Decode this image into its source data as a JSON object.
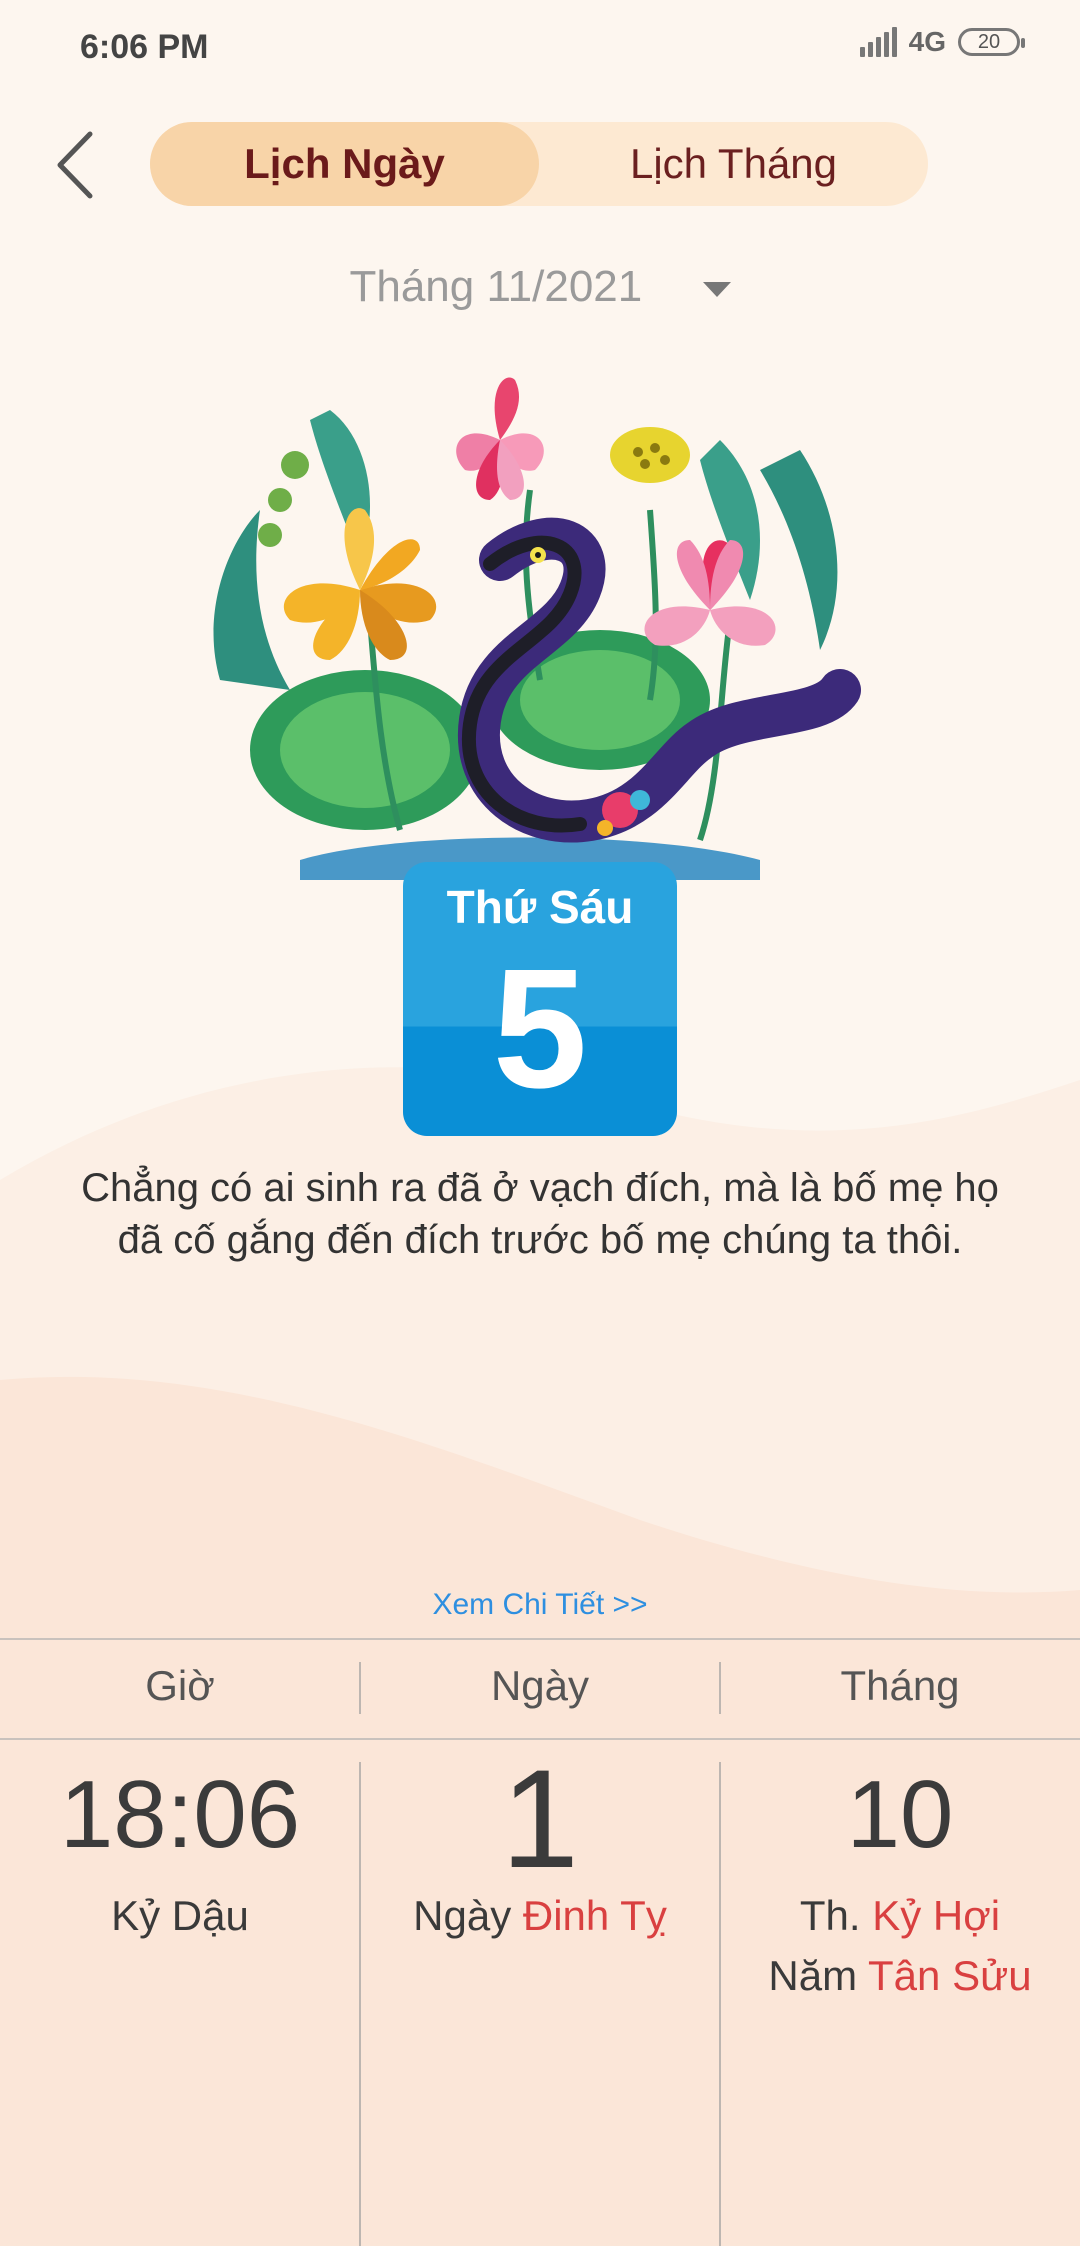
{
  "status_bar": {
    "time": "6:06 PM",
    "network": "4G",
    "battery": "20"
  },
  "tabs": [
    {
      "label": "Lịch Ngày",
      "active": true
    },
    {
      "label": "Lịch Tháng",
      "active": false
    }
  ],
  "month_selector": {
    "label": "Tháng 11/2021"
  },
  "day_card": {
    "weekday": "Thứ Sáu",
    "day": "5"
  },
  "quote": "Chẳng có ai sinh ra đã ở vạch đích, mà là bố mẹ họ đã cố gắng đến đích trước bố mẹ chúng ta thôi.",
  "detail_link": "Xem Chi Tiết >>",
  "info": {
    "hour": {
      "header": "Giờ",
      "value": "18:06",
      "caption": "Kỷ Dậu"
    },
    "day": {
      "header": "Ngày",
      "value": "1",
      "caption_prefix": "Ngày",
      "caption_name": "Đinh Tỵ"
    },
    "month": {
      "header": "Tháng",
      "value": "10",
      "month_prefix": "Th.",
      "month_name": "Kỷ Hợi",
      "year_prefix": "Năm",
      "year_name": "Tân Sửu"
    }
  },
  "colors": {
    "accent_blue": "#29a3de",
    "tab_active": "#f8d4a8",
    "highlight_red": "#d94040",
    "link_blue": "#2e8fe0"
  },
  "icons": {
    "back": "chevron-left-icon",
    "dropdown": "caret-down-icon",
    "artwork": "snake-lotus-illustration"
  }
}
